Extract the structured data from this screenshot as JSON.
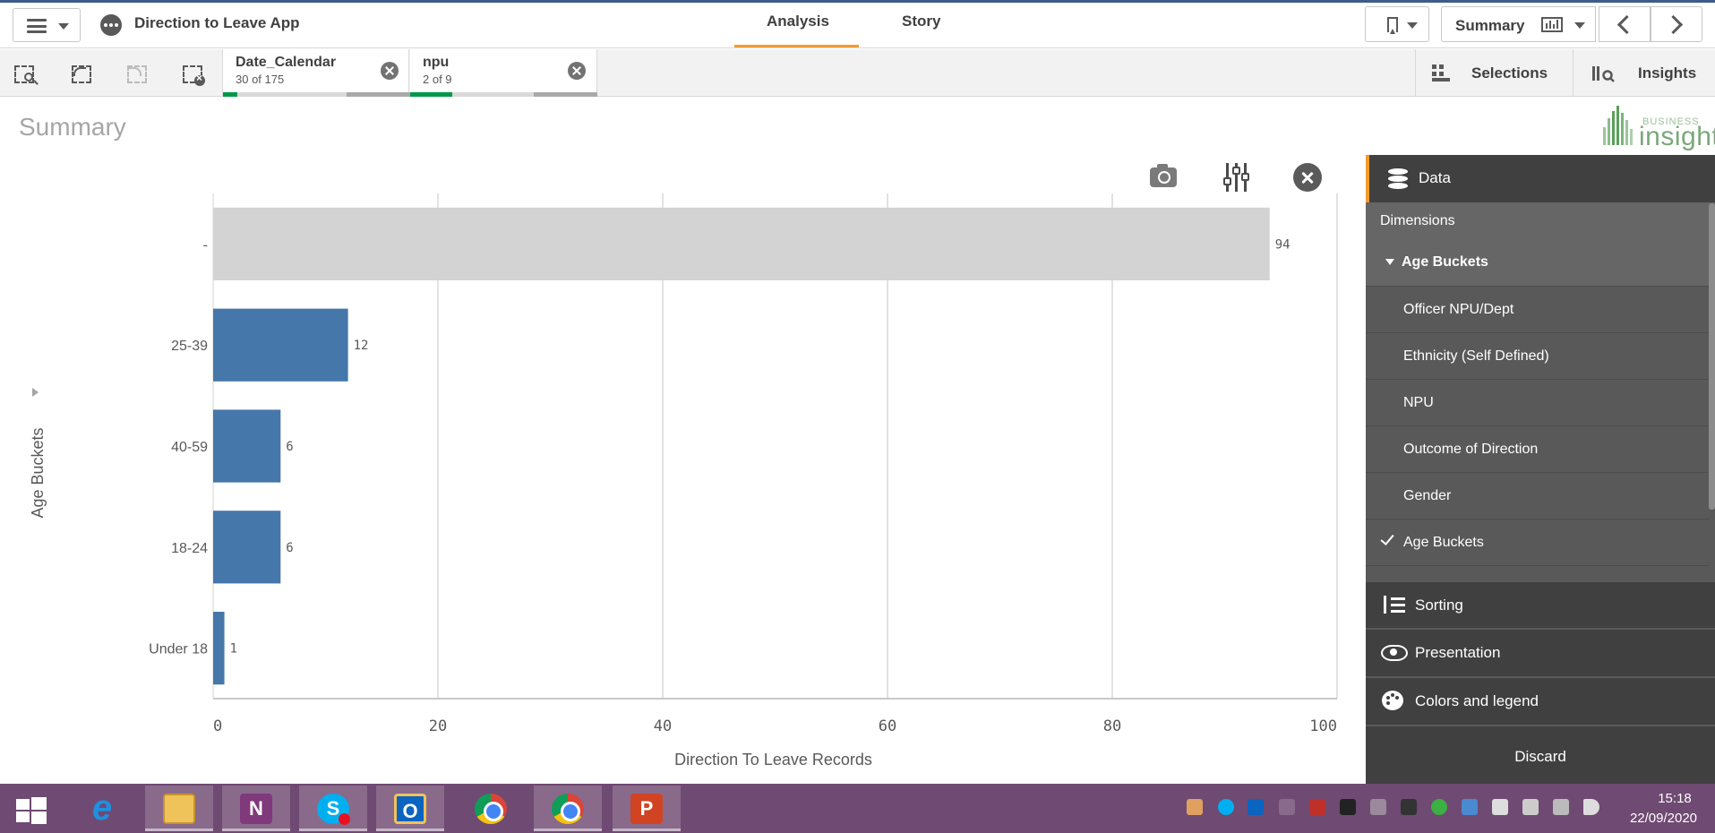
{
  "app": {
    "title": "Direction to Leave App",
    "tabs": [
      {
        "label": "Analysis",
        "active": true
      },
      {
        "label": "Story",
        "active": false
      }
    ],
    "sheet_selector": "Summary"
  },
  "selections": {
    "chips": [
      {
        "name": "Date_Calendar",
        "count": "30 of 175"
      },
      {
        "name": "npu",
        "count": "2 of 9"
      }
    ],
    "selections_label": "Selections",
    "insights_label": "Insights"
  },
  "sheet": {
    "title": "Summary",
    "logo_small": "BUSINESS",
    "logo_big": "insight"
  },
  "chart_data": {
    "type": "bar",
    "orientation": "horizontal",
    "categories": [
      "-",
      "25-39",
      "40-59",
      "18-24",
      "Under 18"
    ],
    "values": [
      94,
      12,
      6,
      6,
      1
    ],
    "colors": [
      "#d3d3d3",
      "#4577aa",
      "#4577aa",
      "#4577aa",
      "#4577aa"
    ],
    "xlabel": "Direction To Leave Records",
    "ylabel": "Age Buckets",
    "xlim": [
      0,
      100
    ],
    "xticks": [
      0,
      20,
      40,
      60,
      80,
      100
    ],
    "grid": true
  },
  "panel": {
    "data_label": "Data",
    "dimensions_label": "Dimensions",
    "expanded_dimension": "Age Buckets",
    "fields": [
      "Officer NPU/Dept",
      "Ethnicity (Self Defined)",
      "NPU",
      "Outcome of Direction",
      "Gender",
      "Age Buckets"
    ],
    "selected_field": "Age Buckets",
    "sorting_label": "Sorting",
    "presentation_label": "Presentation",
    "colors_label": "Colors and legend",
    "discard_label": "Discard",
    "accent_color": "#f29a2e"
  },
  "taskbar": {
    "time": "15:18",
    "date": "22/09/2020",
    "onenote_letter": "N",
    "outlook_letter": "O",
    "powerpoint_letter": "P"
  }
}
